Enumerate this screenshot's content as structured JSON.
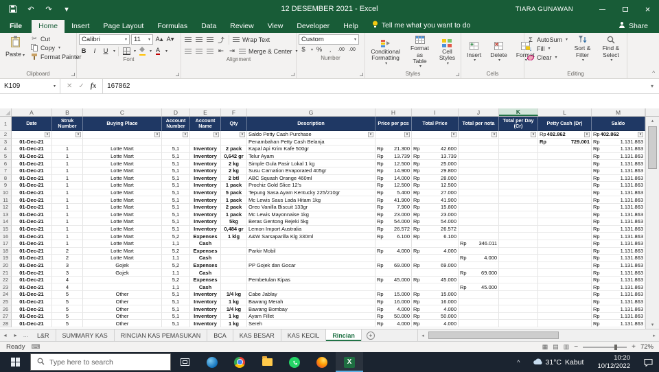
{
  "title_bar": {
    "title": "12 DESEMBER 2021 - Excel",
    "user": "TIARA GUNAWAN"
  },
  "icons": {
    "dropdown": "▾",
    "undo": "↶",
    "redo": "↷",
    "ellipsis": "…",
    "left_arrow": "◂",
    "right_arrow": "▸",
    "up_arrow": "▴",
    "down_arrow": "▾",
    "close": "×",
    "checkmark": "✓",
    "cancel": "✕",
    "sigma": "Σ",
    "collapse": "^",
    "scissors": "✂",
    "bold": "B",
    "italic": "I",
    "underline": "U",
    "percent": "%",
    "comma": ",",
    "decimals": ".00",
    "currency": "$",
    "fill_down": "↓",
    "keyboard": "⌨",
    "view_normal": "▦",
    "view_layout": "▤",
    "view_break": "▥",
    "minus": "−",
    "plus": "+",
    "select_all_triangle": "◢",
    "new_sheet": "+"
  },
  "colors": {
    "excel_green": "#185C37",
    "accent_green": "#217346",
    "header_blue": "#1F3864",
    "taskbar": "#1B2430"
  },
  "ribbon": {
    "tabs": [
      "File",
      "Home",
      "Insert",
      "Page Layout",
      "Formulas",
      "Data",
      "Review",
      "View",
      "Developer",
      "Help"
    ],
    "active_tab": "Home",
    "tell_me": "Tell me what you want to do",
    "share_label": "Share",
    "clipboard": {
      "group_label": "Clipboard",
      "paste": "Paste",
      "cut": "Cut",
      "copy": "Copy",
      "format_painter": "Format Painter"
    },
    "font": {
      "group_label": "Font",
      "font_name": "Calibri",
      "font_size": "11"
    },
    "alignment": {
      "group_label": "Alignment",
      "wrap_text": "Wrap Text",
      "merge_center": "Merge & Center"
    },
    "number": {
      "group_label": "Number",
      "number_format": "Custom"
    },
    "styles": {
      "group_label": "Styles",
      "conditional": "Conditional Formatting",
      "format_table": "Format as Table",
      "cell_styles": "Cell Styles"
    },
    "cells": {
      "group_label": "Cells",
      "insert": "Insert",
      "delete": "Delete",
      "format": "Format"
    },
    "editing": {
      "group_label": "Editing",
      "autosum": "AutoSum",
      "fill": "Fill",
      "clear": "Clear",
      "sort_filter": "Sort & Filter",
      "find_select": "Find & Select"
    }
  },
  "formula_bar": {
    "name_box": "K109",
    "fx_label": "fx",
    "content": "167862"
  },
  "grid": {
    "currency_prefix": "Rp",
    "column_letters": [
      "A",
      "B",
      "C",
      "D",
      "E",
      "F",
      "G",
      "H",
      "I",
      "J",
      "K",
      "L",
      "M"
    ],
    "selected_column": "K",
    "headers": [
      "Date",
      "Struk Number",
      "Buying Place",
      "Account Number",
      "Account Name",
      "Qty",
      "Description",
      "Price per pcs",
      "Total Price",
      "Total per nota",
      "Total per Day (Cr)",
      "Petty Cash (Dr)",
      "Saldo"
    ],
    "filter_row": {
      "row_number": "2",
      "description": "Saldo Petty Cash Purchase",
      "petty_cash": "402.862",
      "saldo": "402.862"
    },
    "rows": [
      {
        "n": "3",
        "date": "01-Dec-21",
        "struk": "",
        "place": "",
        "acct_no": "",
        "acct_name": "",
        "qty": "",
        "desc": "Penambahan Petty Cash Belanja",
        "price": "",
        "total": "",
        "nota": "",
        "day": "",
        "petty": "729.001",
        "saldo": "1.131.863",
        "petty_bold": true
      },
      {
        "n": "4",
        "date": "01-Dec-21",
        "struk": "1",
        "place": "Lotte Mart",
        "acct_no": "5,1",
        "acct_name": "Inventory",
        "qty": "2 pack",
        "desc": "Kapal Api Krim Kafe 500gr",
        "price": "21.300",
        "total": "42.600",
        "nota": "",
        "day": "",
        "petty": "",
        "saldo": "1.131.863"
      },
      {
        "n": "5",
        "date": "01-Dec-21",
        "struk": "1",
        "place": "Lotte Mart",
        "acct_no": "5,1",
        "acct_name": "Inventory",
        "qty": "0,642 gr",
        "desc": "Telur Ayam",
        "price": "13.739",
        "total": "13.739",
        "nota": "",
        "day": "",
        "petty": "",
        "saldo": "1.131.863"
      },
      {
        "n": "6",
        "date": "01-Dec-21",
        "struk": "1",
        "place": "Lotte Mart",
        "acct_no": "5,1",
        "acct_name": "Inventory",
        "qty": "2 kg",
        "desc": "Simple Gula Pasir Lokal 1 kg",
        "price": "12.500",
        "total": "25.000",
        "nota": "",
        "day": "",
        "petty": "",
        "saldo": "1.131.863"
      },
      {
        "n": "7",
        "date": "01-Dec-21",
        "struk": "1",
        "place": "Lotte Mart",
        "acct_no": "5,1",
        "acct_name": "Inventory",
        "qty": "2 kg",
        "desc": "Susu Carnation Evaporated 405gr",
        "price": "14.900",
        "total": "29.800",
        "nota": "",
        "day": "",
        "petty": "",
        "saldo": "1.131.863"
      },
      {
        "n": "8",
        "date": "01-Dec-21",
        "struk": "1",
        "place": "Lotte Mart",
        "acct_no": "5,1",
        "acct_name": "Inventory",
        "qty": "2 btl",
        "desc": "ABC Squash Orange 460ml",
        "price": "14.000",
        "total": "28.000",
        "nota": "",
        "day": "",
        "petty": "",
        "saldo": "1.131.863"
      },
      {
        "n": "9",
        "date": "01-Dec-21",
        "struk": "1",
        "place": "Lotte Mart",
        "acct_no": "5,1",
        "acct_name": "Inventory",
        "qty": "1 pack",
        "desc": "Prochiz Gold Slice 12's",
        "price": "12.500",
        "total": "12.500",
        "nota": "",
        "day": "",
        "petty": "",
        "saldo": "1.131.863"
      },
      {
        "n": "10",
        "date": "01-Dec-21",
        "struk": "1",
        "place": "Lotte Mart",
        "acct_no": "5,1",
        "acct_name": "Inventory",
        "qty": "5 pack",
        "desc": "Tepung Sasa Ayam Kentucky 225/210gr",
        "price": "5.400",
        "total": "27.000",
        "nota": "",
        "day": "",
        "petty": "",
        "saldo": "1.131.863"
      },
      {
        "n": "11",
        "date": "01-Dec-21",
        "struk": "1",
        "place": "Lotte Mart",
        "acct_no": "5,1",
        "acct_name": "Inventory",
        "qty": "1 pack",
        "desc": "Mc Lewis Saus Lada Hitam 1kg",
        "price": "41.900",
        "total": "41.900",
        "nota": "",
        "day": "",
        "petty": "",
        "saldo": "1.131.863"
      },
      {
        "n": "12",
        "date": "01-Dec-21",
        "struk": "1",
        "place": "Lotte Mart",
        "acct_no": "5,1",
        "acct_name": "Inventory",
        "qty": "2 pack",
        "desc": "Oreo Vanilla Biscuit 133gr",
        "price": "7.900",
        "total": "15.800",
        "nota": "",
        "day": "",
        "petty": "",
        "saldo": "1.131.863"
      },
      {
        "n": "13",
        "date": "01-Dec-21",
        "struk": "1",
        "place": "Lotte Mart",
        "acct_no": "5,1",
        "acct_name": "Inventory",
        "qty": "1 pack",
        "desc": "Mc Lewis Mayonnaise 1kg",
        "price": "23.000",
        "total": "23.000",
        "nota": "",
        "day": "",
        "petty": "",
        "saldo": "1.131.863"
      },
      {
        "n": "14",
        "date": "01-Dec-21",
        "struk": "1",
        "place": "Lotte Mart",
        "acct_no": "5,1",
        "acct_name": "Inventory",
        "qty": "5kg",
        "desc": "Beras Gentong Rejeki 5kg",
        "price": "54.000",
        "total": "54.000",
        "nota": "",
        "day": "",
        "petty": "",
        "saldo": "1.131.863"
      },
      {
        "n": "15",
        "date": "01-Dec-21",
        "struk": "1",
        "place": "Lotte Mart",
        "acct_no": "5,1",
        "acct_name": "Inventory",
        "qty": "0,484 gr",
        "desc": "Lemon Import Australia",
        "price": "26.572",
        "total": "26.572",
        "nota": "",
        "day": "",
        "petty": "",
        "saldo": "1.131.863"
      },
      {
        "n": "16",
        "date": "01-Dec-21",
        "struk": "1",
        "place": "Lotte Mart",
        "acct_no": "5,2",
        "acct_name": "Expenses",
        "qty": "1 klg",
        "desc": "A&W Sarsaparilla Klg 330ml",
        "price": "6.100",
        "total": "6.100",
        "nota": "",
        "day": "",
        "petty": "",
        "saldo": "1.131.863"
      },
      {
        "n": "17",
        "date": "01-Dec-21",
        "struk": "1",
        "place": "Lotte Mart",
        "acct_no": "1,1",
        "acct_name": "Cash",
        "qty": "",
        "desc": "",
        "price": "",
        "total": "",
        "nota": "346.011",
        "day": "",
        "petty": "",
        "saldo": "1.131.863"
      },
      {
        "n": "18",
        "date": "01-Dec-21",
        "struk": "2",
        "place": "Lotte Mart",
        "acct_no": "5,2",
        "acct_name": "Expenses",
        "qty": "",
        "desc": "Parkir Mobil",
        "price": "4.000",
        "total": "4.000",
        "nota": "",
        "day": "",
        "petty": "",
        "saldo": "1.131.863"
      },
      {
        "n": "19",
        "date": "01-Dec-21",
        "struk": "2",
        "place": "Lotte Mart",
        "acct_no": "1,1",
        "acct_name": "Cash",
        "qty": "",
        "desc": "",
        "price": "",
        "total": "",
        "nota": "4.000",
        "day": "",
        "petty": "",
        "saldo": "1.131.863"
      },
      {
        "n": "20",
        "date": "01-Dec-21",
        "struk": "3",
        "place": "Gojek",
        "acct_no": "5,2",
        "acct_name": "Expenses",
        "qty": "",
        "desc": "PP Gojek dan Gocar",
        "price": "69.000",
        "total": "69.000",
        "nota": "",
        "day": "",
        "petty": "",
        "saldo": "1.131.863"
      },
      {
        "n": "21",
        "date": "01-Dec-21",
        "struk": "3",
        "place": "Gojek",
        "acct_no": "1,1",
        "acct_name": "Cash",
        "qty": "",
        "desc": "",
        "price": "",
        "total": "",
        "nota": "69.000",
        "day": "",
        "petty": "",
        "saldo": "1.131.863"
      },
      {
        "n": "22",
        "date": "01-Dec-21",
        "struk": "4",
        "place": "",
        "acct_no": "5,2",
        "acct_name": "Expenses",
        "qty": "",
        "desc": "Pembetulan Kipas",
        "price": "45.000",
        "total": "45.000",
        "nota": "",
        "day": "",
        "petty": "",
        "saldo": "1.131.863"
      },
      {
        "n": "23",
        "date": "01-Dec-21",
        "struk": "4",
        "place": "",
        "acct_no": "1,1",
        "acct_name": "Cash",
        "qty": "",
        "desc": "",
        "price": "",
        "total": "",
        "nota": "45.000",
        "day": "",
        "petty": "",
        "saldo": "1.131.863"
      },
      {
        "n": "24",
        "date": "01-Dec-21",
        "struk": "5",
        "place": "Other",
        "acct_no": "5,1",
        "acct_name": "Inventory",
        "qty": "1/4 kg",
        "desc": "Cabe Jablay",
        "price": "15.000",
        "total": "15.000",
        "nota": "",
        "day": "",
        "petty": "",
        "saldo": "1.131.863"
      },
      {
        "n": "25",
        "date": "01-Dec-21",
        "struk": "5",
        "place": "Other",
        "acct_no": "5,1",
        "acct_name": "Inventory",
        "qty": "1 kg",
        "desc": "Bawang Merah",
        "price": "16.000",
        "total": "16.000",
        "nota": "",
        "day": "",
        "petty": "",
        "saldo": "1.131.863"
      },
      {
        "n": "26",
        "date": "01-Dec-21",
        "struk": "5",
        "place": "Other",
        "acct_no": "5,1",
        "acct_name": "Inventory",
        "qty": "1/4 kg",
        "desc": "Bawang Bombay",
        "price": "4.000",
        "total": "4.000",
        "nota": "",
        "day": "",
        "petty": "",
        "saldo": "1.131.863"
      },
      {
        "n": "27",
        "date": "01-Dec-21",
        "struk": "5",
        "place": "Other",
        "acct_no": "5,1",
        "acct_name": "Inventory",
        "qty": "1 kg",
        "desc": "Ayam Fillet",
        "price": "50.000",
        "total": "50.000",
        "nota": "",
        "day": "",
        "petty": "",
        "saldo": "1.131.863"
      },
      {
        "n": "28",
        "date": "01-Dec-21",
        "struk": "5",
        "place": "Other",
        "acct_no": "5,1",
        "acct_name": "Inventory",
        "qty": "1 kg",
        "desc": "Sereh",
        "price": "4.000",
        "total": "4.000",
        "nota": "",
        "day": "",
        "petty": "",
        "saldo": "1.131.863"
      }
    ]
  },
  "sheet_tabs": {
    "tabs": [
      "L&R",
      "SUMMARY KAS",
      "RINCIAN KAS PEMASUKAN",
      "BCA",
      "KAS BESAR",
      "KAS KECIL",
      "Rincian"
    ],
    "active_tab": "Rincian"
  },
  "status_bar": {
    "mode": "Ready",
    "zoom": "72%"
  },
  "taskbar": {
    "search_placeholder": "Type here to search",
    "weather_temp": "31°C",
    "weather_cond": "Kabut",
    "time": "10:20",
    "date": "10/12/2022"
  }
}
